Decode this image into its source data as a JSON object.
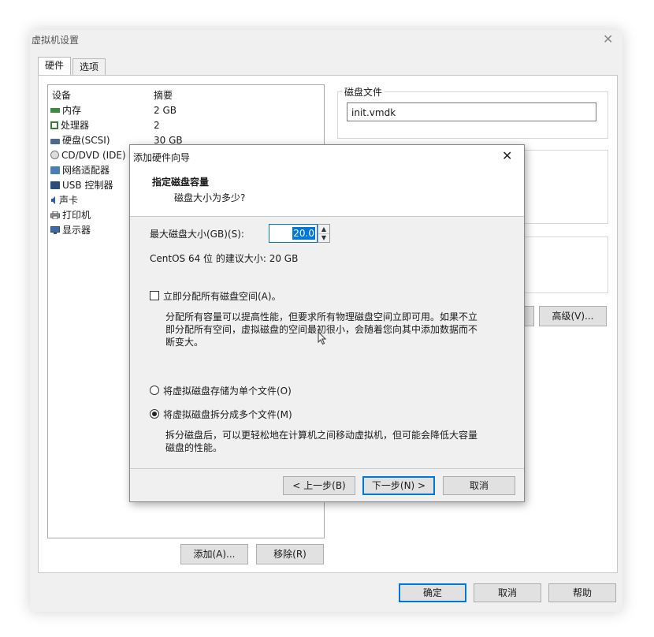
{
  "window": {
    "title": "虚拟机设置",
    "tabs": [
      "硬件",
      "选项"
    ]
  },
  "device_list": {
    "headers": [
      "设备",
      "摘要"
    ],
    "rows": [
      {
        "name": "内存",
        "summary": "2 GB",
        "icon": "memory-icon"
      },
      {
        "name": "处理器",
        "summary": "2",
        "icon": "cpu-icon"
      },
      {
        "name": "硬盘(SCSI)",
        "summary": "30 GB",
        "icon": "hard-disk-icon"
      },
      {
        "name": "CD/DVD (IDE)",
        "summary": "",
        "icon": "cd-icon"
      },
      {
        "name": "网络适配器",
        "summary": "",
        "icon": "network-icon"
      },
      {
        "name": "USB 控制器",
        "summary": "",
        "icon": "usb-icon"
      },
      {
        "name": "声卡",
        "summary": "",
        "icon": "sound-icon"
      },
      {
        "name": "打印机",
        "summary": "",
        "icon": "printer-icon"
      },
      {
        "name": "显示器",
        "summary": "",
        "icon": "monitor-icon"
      }
    ],
    "add_button": "添加(A)...",
    "remove_button": "移除(R)"
  },
  "right_panel": {
    "disk_file_label": "磁盘文件",
    "disk_file_value": "init.vmdk",
    "advanced_button": "高级(V)..."
  },
  "footer": {
    "ok": "确定",
    "cancel": "取消",
    "help": "帮助"
  },
  "wizard": {
    "title": "添加硬件向导",
    "heading": "指定磁盘容量",
    "subheading": "磁盘大小为多少?",
    "max_size_label": "最大磁盘大小(GB)(S):",
    "max_size_value": "20.0",
    "recommend_text": "CentOS 64 位 的建议大小: 20 GB",
    "allocate_label": "立即分配所有磁盘空间(A)。",
    "allocate_checked": false,
    "allocate_desc_1": "分配所有容量可以提高性能，但要求所有物理磁盘空间立即可用。如果不立",
    "allocate_desc_2": "即分配所有空间，虚拟磁盘的空间最初很小，会随着您向其中添加数据而不",
    "allocate_desc_3": "断变大。",
    "radio_single": "将虚拟磁盘存储为单个文件(O)",
    "radio_multi": "将虚拟磁盘拆分成多个文件(M)",
    "selected_option": "multi",
    "split_desc_1": "拆分磁盘后，可以更轻松地在计算机之间移动虚拟机，但可能会降低大容量",
    "split_desc_2": "磁盘的性能。",
    "back_button": "< 上一步(B)",
    "next_button": "下一步(N) >",
    "cancel_button": "取消"
  }
}
